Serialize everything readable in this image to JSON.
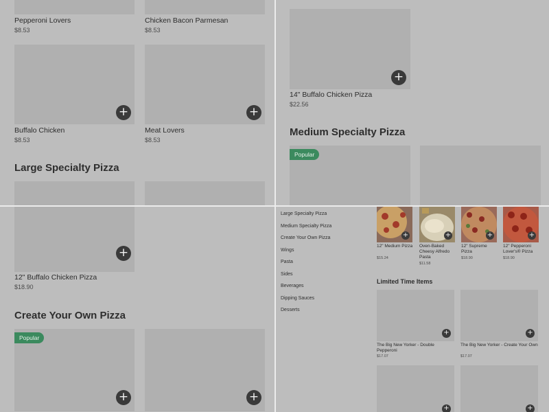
{
  "tl": {
    "items": [
      {
        "name": "Pepperoni Lovers",
        "price": "$8.53"
      },
      {
        "name": "Chicken Bacon Parmesan",
        "price": "$8.53"
      },
      {
        "name": "Buffalo Chicken",
        "price": "$8.53"
      },
      {
        "name": "Meat Lovers",
        "price": "$8.53"
      }
    ],
    "section_title": "Large Specialty Pizza"
  },
  "tr": {
    "item": {
      "name": "14\" Buffalo Chicken Pizza",
      "price": "$22.56"
    },
    "section_title": "Medium Specialty Pizza",
    "badge": "Popular"
  },
  "bl": {
    "item": {
      "name": "12\" Buffalo Chicken Pizza",
      "price": "$18.90"
    },
    "section_title": "Create Your Own Pizza",
    "badge": "Popular"
  },
  "br": {
    "nav": [
      "Large Specialty Pizza",
      "Medium Specialty Pizza",
      "Create Your Own Pizza",
      "Wings",
      "Pasta",
      "Sides",
      "Beverages",
      "Dipping Sauces",
      "Desserts"
    ],
    "featured": [
      {
        "name": "12\" Medium Pizza",
        "price": "$15.24"
      },
      {
        "name": "Oven-Baked Cheesy Alfredo Pasta",
        "price": "$11.58"
      },
      {
        "name": "12\" Supreme Pizza",
        "price": "$18.90"
      },
      {
        "name": "12\" Pepperoni Lover's® Pizza",
        "price": "$18.90"
      }
    ],
    "limited_title": "Limited Time Items",
    "limited": [
      {
        "name": "The Big New Yorker - Double Pepperoni",
        "price": "$17.07"
      },
      {
        "name": "The Big New Yorker - Create Your Own",
        "price": "$17.07"
      }
    ]
  },
  "icons": {
    "add": "plus-icon"
  },
  "colors": {
    "badge": "#3b8a5e",
    "add_button": "#3a3a3a"
  }
}
